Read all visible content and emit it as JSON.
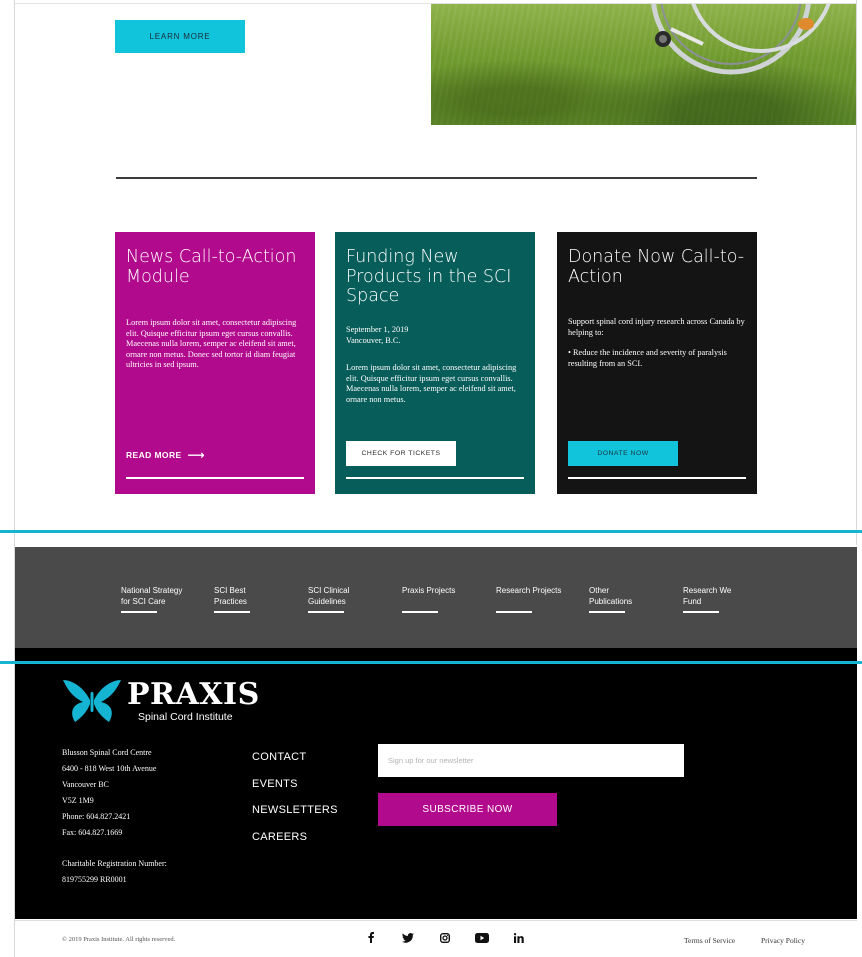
{
  "hero": {
    "learn_more_label": "LEARN MORE"
  },
  "cards": {
    "news": {
      "title": "News Call-to-Action Module",
      "body": "Lorem ipsum dolor sit amet, consectetur adipiscing elit. Quisque efficitur ipsum eget cursus convallis. Maecenas nulla lorem, semper ac eleifend sit amet, ornare non metus. Donec sed tortor id diam feugiat ultricies in sed ipsum.",
      "read_more_label": "READ MORE",
      "color": "#b10a8c"
    },
    "funding": {
      "title": "Funding New Products in the SCI Space",
      "date": "September 1, 2019",
      "location": "Vancouver, B.C.",
      "body": "Lorem ipsum dolor sit amet, consectetur adipiscing elit. Quisque efficitur ipsum eget cursus convallis. Maecenas nulla lorem, semper ac eleifend sit amet, ornare non metus.",
      "button_label": "CHECK FOR TICKETS",
      "color": "#075d59"
    },
    "donate": {
      "title": "Donate Now Call-to-Action",
      "intro": "Support spinal cord injury research across Canada by helping to:",
      "bullet": "• Reduce the incidence and severity of paralysis resulting from an SCI.",
      "button_label": "DONATE NOW",
      "color": "#141414"
    }
  },
  "nav": {
    "items": [
      {
        "label": "National Strategy\nfor SCI Care"
      },
      {
        "label": "SCI Best\nPractices"
      },
      {
        "label": "SCI Clinical\nGuidelines"
      },
      {
        "label": "Praxis Projects"
      },
      {
        "label": "Research Projects"
      },
      {
        "label": "Other\nPublications"
      },
      {
        "label": "Research We\nFund"
      }
    ]
  },
  "footer": {
    "logo_word": "PRAXIS",
    "logo_sub": "Spinal Cord Institute",
    "address": {
      "line1": "Blusson Spinal Cord Centre",
      "line2": "6400 - 818 West 10th Avenue",
      "line3": "Vancouver BC",
      "line4": "V5Z 1M9",
      "phone": "Phone: 604.827.2421",
      "fax": "Fax: 604.827.1669",
      "charity_label": "Charitable Registration Number:",
      "charity_number": "819755299 RR0001"
    },
    "links": [
      "CONTACT",
      "EVENTS",
      "NEWSLETTERS",
      "CAREERS"
    ],
    "newsletter_placeholder": "Sign up for our newsletter",
    "subscribe_label": "SUBSCRIBE NOW",
    "accent_color": "#14b4d2"
  },
  "bottom": {
    "copyright": "© 2019 Praxis Institute. All rights reserved.",
    "social_icons": [
      "facebook-icon",
      "twitter-icon",
      "instagram-icon",
      "youtube-icon",
      "linkedin-icon"
    ],
    "terms_label": "Terms of Service",
    "privacy_label": "Privacy Policy"
  }
}
